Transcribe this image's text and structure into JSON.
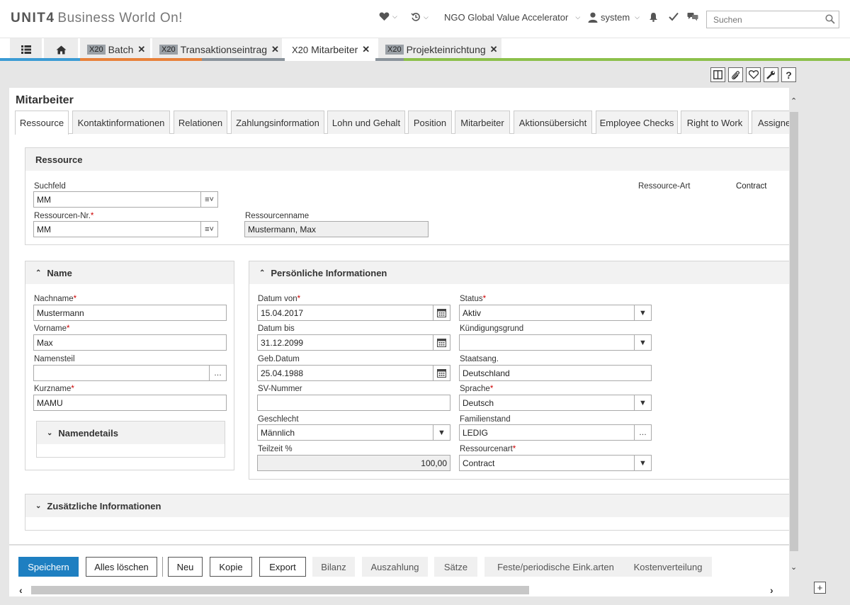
{
  "header": {
    "brand": "UNIT4",
    "product": "Business World On!",
    "company": "NGO Global Value Accelerator",
    "user": "system",
    "search_placeholder": "Suchen"
  },
  "app_tabs": [
    {
      "badge": "",
      "label": "",
      "icon": "grid-menu-icon"
    },
    {
      "badge": "",
      "label": "",
      "icon": "home-icon"
    },
    {
      "badge": "X20",
      "label": "Batch"
    },
    {
      "badge": "X20",
      "label": "Transaktionseintrag"
    },
    {
      "badge": "X20",
      "label": "Mitarbeiter",
      "active": true
    },
    {
      "badge": "X20",
      "label": "Projekteinrichtung"
    }
  ],
  "page": {
    "title": "Mitarbeiter"
  },
  "sub_tabs": [
    "Ressource",
    "Kontaktinformationen",
    "Relationen",
    "Zahlungsinformation",
    "Lohn und Gehalt",
    "Position",
    "Mitarbeiter",
    "Aktionsübersicht",
    "Employee Checks",
    "Right to Work",
    "Assigne"
  ],
  "ressource": {
    "title": "Ressource",
    "suchfeld_label": "Suchfeld",
    "suchfeld_value": "MM",
    "nr_label": "Ressourcen-Nr.",
    "nr_value": "MM",
    "name_label": "Ressourcenname",
    "name_value": "Mustermann, Max",
    "art_label": "Ressource-Art",
    "art_value": "Contract"
  },
  "name_section": {
    "title": "Name",
    "nachname_label": "Nachname",
    "nachname_value": "Mustermann",
    "vorname_label": "Vorname",
    "vorname_value": "Max",
    "namensteil_label": "Namensteil",
    "namensteil_value": "",
    "kurzname_label": "Kurzname",
    "kurzname_value": "MAMU",
    "details_title": "Namendetails"
  },
  "personal": {
    "title": "Persönliche Informationen",
    "datum_von_label": "Datum von",
    "datum_von_value": "15.04.2017",
    "datum_bis_label": "Datum bis",
    "datum_bis_value": "31.12.2099",
    "geb_label": "Geb.Datum",
    "geb_value": "25.04.1988",
    "sv_label": "SV-Nummer",
    "sv_value": "",
    "geschlecht_label": "Geschlecht",
    "geschlecht_value": "Männlich",
    "teilzeit_label": "Teilzeit %",
    "teilzeit_value": "100,00",
    "status_label": "Status",
    "status_value": "Aktiv",
    "kuend_label": "Kündigungsgrund",
    "kuend_value": "",
    "staatsang_label": "Staatsang.",
    "staatsang_value": "Deutschland",
    "sprache_label": "Sprache",
    "sprache_value": "Deutsch",
    "familienstand_label": "Familienstand",
    "familienstand_value": "LEDIG",
    "ressourcenart_label": "Ressourcenart",
    "ressourcenart_value": "Contract"
  },
  "extra": {
    "title": "Zusätzliche Informationen"
  },
  "buttons": {
    "save": "Speichern",
    "clear": "Alles löschen",
    "new": "Neu",
    "copy": "Kopie",
    "export": "Export",
    "balance": "Bilanz",
    "payout": "Auszahlung",
    "rates": "Sätze",
    "fixed_income": "Feste/periodische Eink.arten",
    "cost_dist": "Kostenverteilung"
  },
  "colors": {
    "primary": "#1e7fc1",
    "required": "#cc0000",
    "tab_orange": "#e8813a",
    "tab_blue": "#3b9bd4",
    "tab_green": "#8cc04b",
    "tab_gray": "#8a939b"
  }
}
